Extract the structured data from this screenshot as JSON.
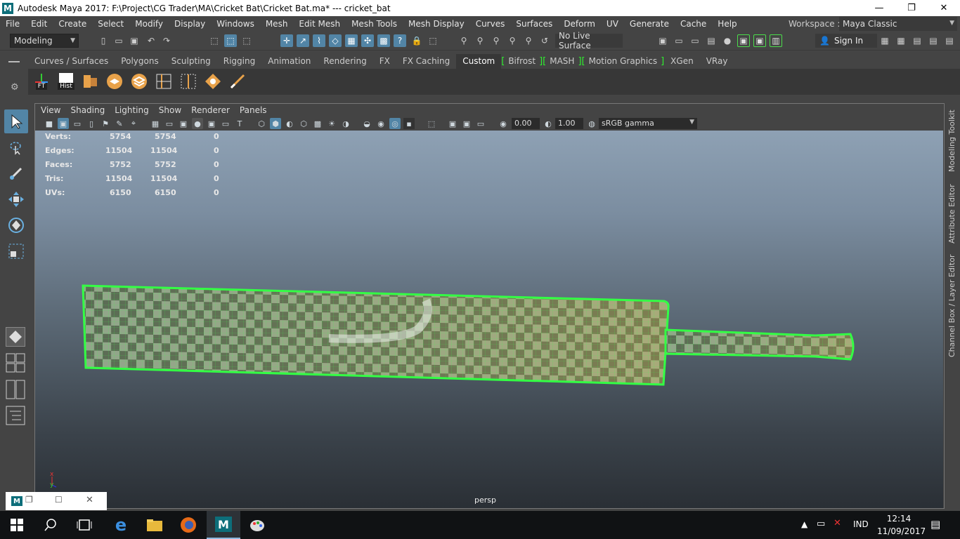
{
  "window": {
    "title": "Autodesk Maya 2017: F:\\Project\\CG Trader\\MA\\Cricket Bat\\Cricket Bat.ma*   ---   cricket_bat",
    "app_glyph": "M",
    "minimize": "—",
    "maximize": "❐",
    "close": "✕"
  },
  "menubar": {
    "items": [
      "File",
      "Edit",
      "Create",
      "Select",
      "Modify",
      "Display",
      "Windows",
      "Mesh",
      "Edit Mesh",
      "Mesh Tools",
      "Mesh Display",
      "Curves",
      "Surfaces",
      "Deform",
      "UV",
      "Generate",
      "Cache",
      "Help"
    ],
    "workspace_label": "Workspace :",
    "workspace_value": "Maya Classic"
  },
  "toolbar": {
    "mode_value": "Modeling",
    "live_surface": "No Live Surface",
    "sign_in": "Sign In"
  },
  "shelf": {
    "tabs": [
      "Curves / Surfaces",
      "Polygons",
      "Sculpting",
      "Rigging",
      "Animation",
      "Rendering",
      "FX",
      "FX Caching",
      "Custom",
      "Bifrost",
      "MASH",
      "Motion Graphics",
      "XGen",
      "VRay"
    ],
    "active_tab": "Custom",
    "buttons": [
      {
        "label": "FT",
        "icon": "freeze-transform-icon"
      },
      {
        "label": "Hist",
        "icon": "delete-history-icon"
      }
    ]
  },
  "panel": {
    "menu": [
      "View",
      "Shading",
      "Lighting",
      "Show",
      "Renderer",
      "Panels"
    ],
    "exposure": "0.00",
    "gamma": "1.00",
    "color_space": "sRGB gamma",
    "camera": "persp"
  },
  "hud": {
    "rows": [
      {
        "label": "Verts:",
        "a": "5754",
        "b": "5754",
        "c": "0"
      },
      {
        "label": "Edges:",
        "a": "11504",
        "b": "11504",
        "c": "0"
      },
      {
        "label": "Faces:",
        "a": "5752",
        "b": "5752",
        "c": "0"
      },
      {
        "label": "Tris:",
        "a": "11504",
        "b": "11504",
        "c": "0"
      },
      {
        "label": "UVs:",
        "a": "6150",
        "b": "6150",
        "c": "0"
      }
    ]
  },
  "right_tabs": [
    "Modeling Toolkit",
    "Attribute Editor",
    "Channel Box / Layer Editor"
  ],
  "axis": {
    "x": "x",
    "y": "y"
  },
  "colors": {
    "accent": "#5285a6",
    "selection": "#33ff44",
    "shelf_bracket": "#2ef02e"
  },
  "taskbar": {
    "lang": "IND",
    "time": "12:14",
    "date": "11/09/2017"
  }
}
